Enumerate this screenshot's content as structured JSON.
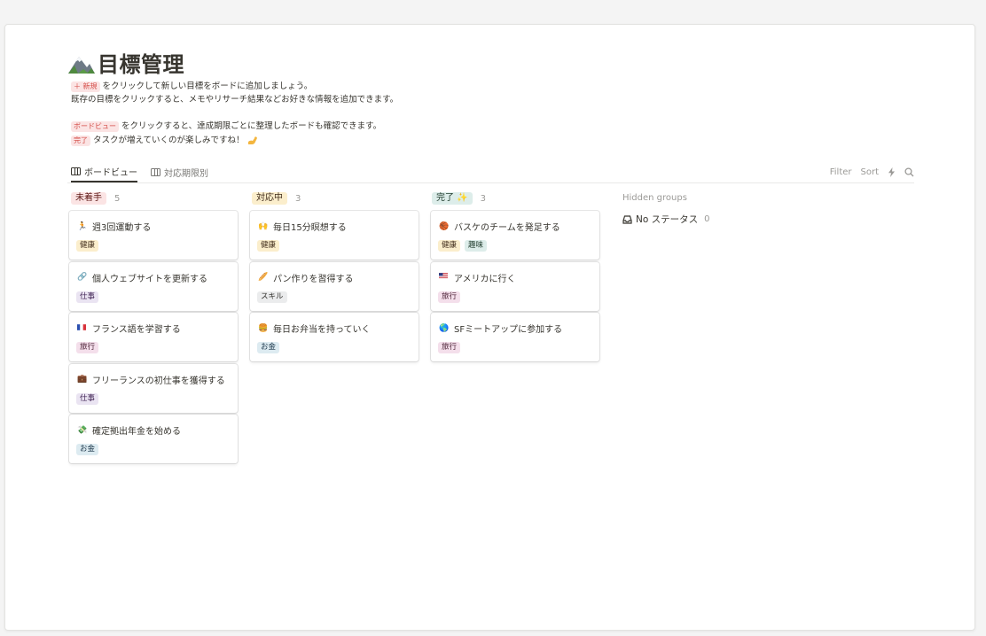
{
  "page": {
    "title": "目標管理",
    "title_icon": "mountain-icon",
    "description": {
      "line1_chip": "＋ 新規",
      "line1_text": "をクリックして新しい目標をボードに追加しましょう。",
      "line2_text": "既存の目標をクリックすると、メモやリサーチ結果などお好きな情報を追加できます。",
      "line3_chip": "ボードビュー",
      "line3_text": "をクリックすると、達成期限ごとに整理したボードも確認できます。",
      "line4_chip": "完了",
      "line4_text": "タスクが増えていくのが楽しみですね！"
    }
  },
  "views": [
    {
      "label": "ボードビュー",
      "active": true
    },
    {
      "label": "対応期限別",
      "active": false
    }
  ],
  "toolbar": {
    "filter": "Filter",
    "sort": "Sort",
    "automation_icon": "lightning-icon",
    "search_icon": "search-icon"
  },
  "colors": {
    "red_bg": "#fbe4e4",
    "red_fg": "#5d1715",
    "yellow_bg": "#fbeecc",
    "yellow_fg": "#402c1b",
    "green_bg": "#ddedea",
    "green_fg": "#1c3829",
    "purple_bg": "#eae4f2",
    "purple_fg": "#412454",
    "blue_bg": "#ddebf1",
    "blue_fg": "#183347",
    "pink_bg": "#f4dfeb",
    "pink_fg": "#4c2337",
    "gray_bg": "#ebeced",
    "gray_fg": "#32302c"
  },
  "columns": [
    {
      "label": "未着手",
      "count": "5",
      "cards": [
        {
          "icon": "runner-icon",
          "emoji": "🏃",
          "title": "週3回運動する",
          "tags": [
            {
              "label": "健康",
              "color": "yellow"
            }
          ]
        },
        {
          "icon": "link-icon",
          "emoji": "🔗",
          "title": "個人ウェブサイトを更新する",
          "tags": [
            {
              "label": "仕事",
              "color": "purple"
            }
          ]
        },
        {
          "icon": "france-flag-icon",
          "emoji": "",
          "title": "フランス語を学習する",
          "tags": [
            {
              "label": "旅行",
              "color": "pink"
            }
          ]
        },
        {
          "icon": "briefcase-icon",
          "emoji": "💼",
          "title": "フリーランスの初仕事を獲得する",
          "tags": [
            {
              "label": "仕事",
              "color": "purple"
            }
          ]
        },
        {
          "icon": "money-wings-icon",
          "emoji": "💸",
          "title": "確定拠出年金を始める",
          "tags": [
            {
              "label": "お金",
              "color": "blue"
            }
          ]
        }
      ]
    },
    {
      "label": "対応中",
      "count": "3",
      "cards": [
        {
          "icon": "raised-hands-icon",
          "emoji": "🙌",
          "title": "毎日15分瞑想する",
          "tags": [
            {
              "label": "健康",
              "color": "yellow"
            }
          ]
        },
        {
          "icon": "baguette-icon",
          "emoji": "🥖",
          "title": "パン作りを習得する",
          "tags": [
            {
              "label": "スキル",
              "color": "gray"
            }
          ]
        },
        {
          "icon": "bento-icon",
          "emoji": "🍔",
          "title": "毎日お弁当を持っていく",
          "tags": [
            {
              "label": "お金",
              "color": "blue"
            }
          ]
        }
      ]
    },
    {
      "label": "完了 ✨",
      "count": "3",
      "cards": [
        {
          "icon": "basketball-icon",
          "emoji": "🏀",
          "title": "バスケのチームを発足する",
          "tags": [
            {
              "label": "健康",
              "color": "yellow"
            },
            {
              "label": "趣味",
              "color": "green"
            }
          ]
        },
        {
          "icon": "us-flag-icon",
          "emoji": "",
          "title": "アメリカに行く",
          "tags": [
            {
              "label": "旅行",
              "color": "pink"
            }
          ]
        },
        {
          "icon": "globe-icon",
          "emoji": "🌎",
          "title": "SFミートアップに参加する",
          "tags": [
            {
              "label": "旅行",
              "color": "pink"
            }
          ]
        }
      ]
    }
  ],
  "hidden_groups": {
    "label": "Hidden groups",
    "items": [
      {
        "icon": "inbox-icon",
        "label": "No ステータス",
        "count": "0"
      }
    ]
  }
}
